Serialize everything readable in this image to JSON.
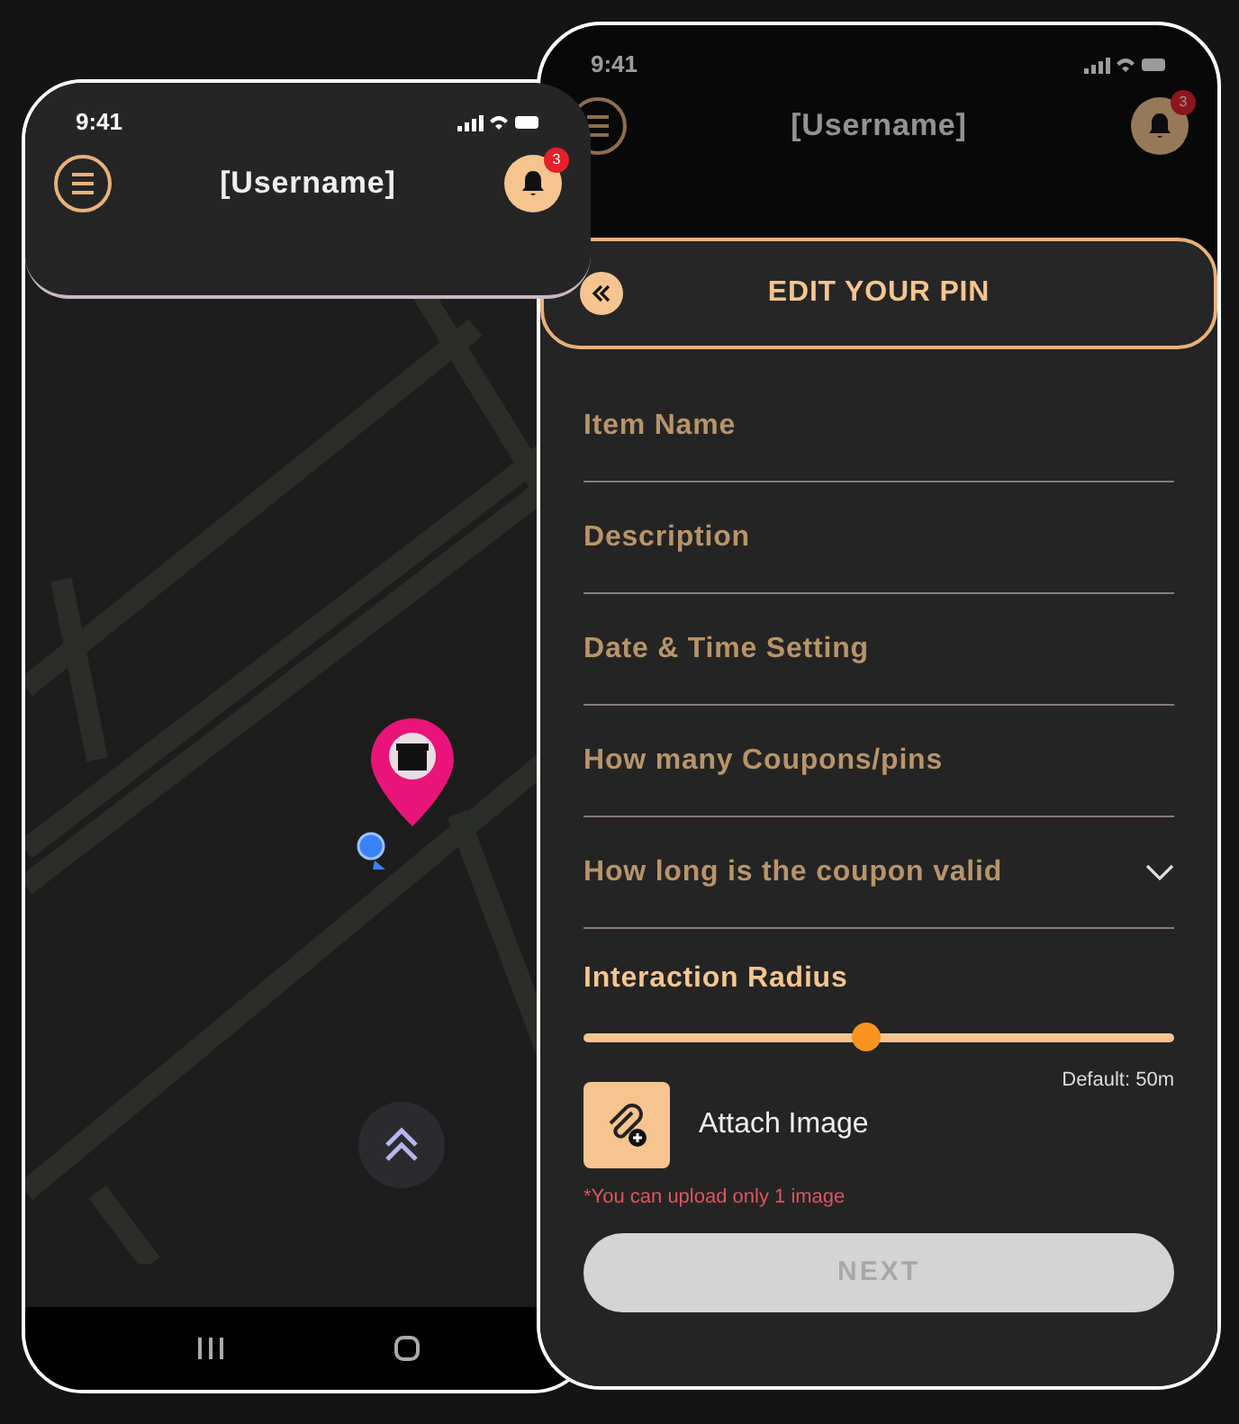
{
  "map_phone": {
    "status_time": "9:41",
    "title": "[Username]",
    "notification_count": "3"
  },
  "edit_phone": {
    "status_time": "9:41",
    "title": "[Username]",
    "notification_count": "3",
    "sheet_title": "EDIT YOUR PIN",
    "fields": [
      {
        "placeholder": "Item Name",
        "kind": "text"
      },
      {
        "placeholder": "Description",
        "kind": "text"
      },
      {
        "placeholder": "Date & Time Setting",
        "kind": "text"
      },
      {
        "placeholder": "How many Coupons/pins",
        "kind": "text"
      },
      {
        "placeholder": "How long is the coupon valid",
        "kind": "dropdown"
      }
    ],
    "radius": {
      "label": "Interaction Radius",
      "level": 0.48,
      "reading": "Default: 50m"
    },
    "attach": {
      "label": "Attach Image",
      "note": "*You can upload only 1 image"
    },
    "next_button": {
      "label": "NEXT",
      "disabled": true
    }
  }
}
